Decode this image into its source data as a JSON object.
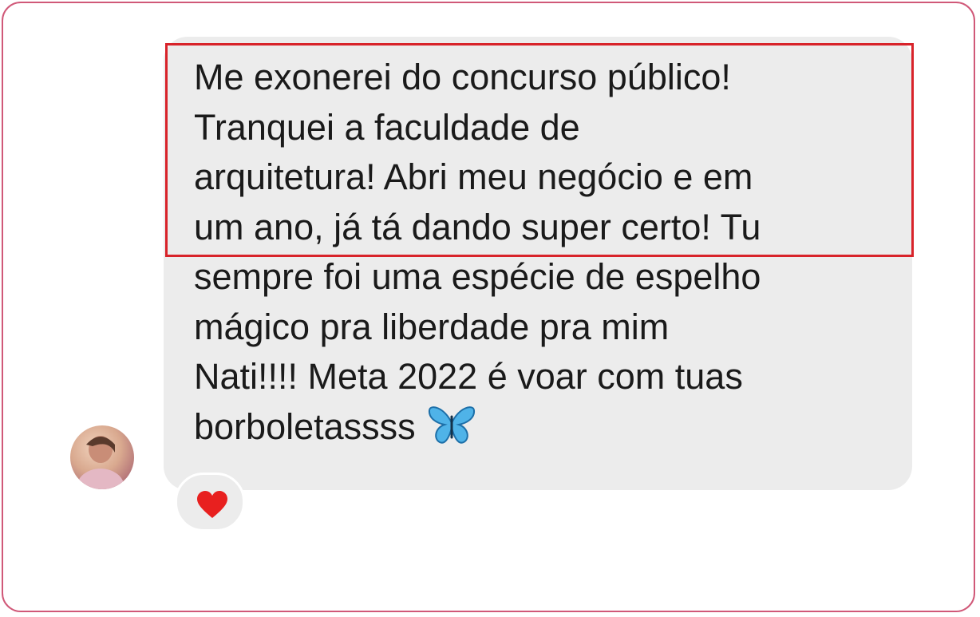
{
  "message": {
    "lines": [
      "Me exonerei do concurso público!",
      "Tranquei a faculdade de",
      "arquitetura! Abri meu negócio e em",
      "um ano, já tá dando super certo! Tu",
      "sempre foi uma espécie de espelho",
      "mágico pra liberdade pra mim",
      "Nati!!!!  Meta 2022 é voar com tuas",
      "borboletassss"
    ],
    "trailing_emoji": "butterfly-icon"
  },
  "reaction": {
    "emoji": "heart-icon",
    "color": "#e8201f"
  },
  "colors": {
    "frame_border": "#d05878",
    "bubble_bg": "#ececec",
    "highlight_border": "#d8232a"
  }
}
